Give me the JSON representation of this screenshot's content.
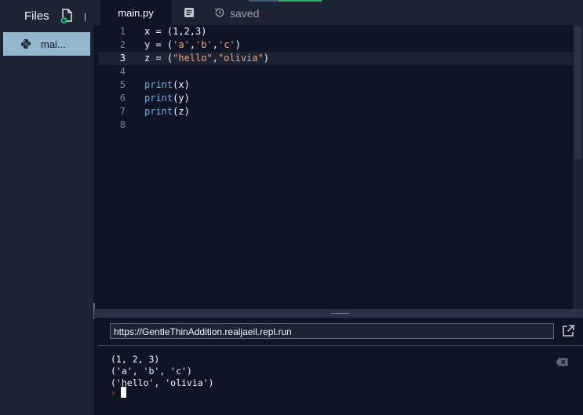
{
  "sidebar": {
    "title": "Files",
    "add_file_icon": "add-file-icon",
    "files": [
      {
        "label": "mai...",
        "icon": "python-icon",
        "selected": true
      }
    ]
  },
  "tabs": {
    "active_tab": "main.py",
    "status": "saved",
    "icons": [
      "document-icon",
      "history-icon"
    ]
  },
  "editor": {
    "active_line": 3,
    "lines": [
      {
        "number": "1",
        "text": "x = (1,2,3)"
      },
      {
        "number": "2",
        "text": "y = ('a','b','c')"
      },
      {
        "number": "3",
        "text": "z = (\"hello\",\"olivia\")"
      },
      {
        "number": "4",
        "text": ""
      },
      {
        "number": "5",
        "text": "print(x)"
      },
      {
        "number": "6",
        "text": "print(y)"
      },
      {
        "number": "7",
        "text": "print(z)"
      },
      {
        "number": "8",
        "text": ""
      }
    ]
  },
  "console": {
    "url": "https://GentleThinAddition.realjaeil.repl.run",
    "output": [
      "(1, 2, 3)",
      "('a', 'b', 'c')",
      "('hello', 'olivia')"
    ],
    "prompt": "›"
  },
  "colors": {
    "background": "#0e1525",
    "panel": "#1c2333",
    "selected_file": "#93b7cf",
    "keyword": "#5ab4f5",
    "string": "#f7a37c",
    "prompt": "#e84f3c"
  }
}
